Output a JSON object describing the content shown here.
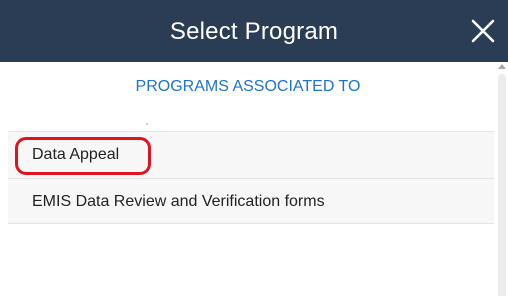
{
  "dialog": {
    "title": "Select Program",
    "close_icon": "close-icon"
  },
  "content": {
    "heading": "PROGRAMS ASSOCIATED TO",
    "programs": [
      {
        "label": "Data Appeal",
        "highlighted": true
      },
      {
        "label": "EMIS Data Review and Verification forms",
        "highlighted": false
      }
    ]
  },
  "colors": {
    "title_bar": "#2b3d54",
    "heading": "#1f73c8",
    "highlight": "#e0141e"
  }
}
